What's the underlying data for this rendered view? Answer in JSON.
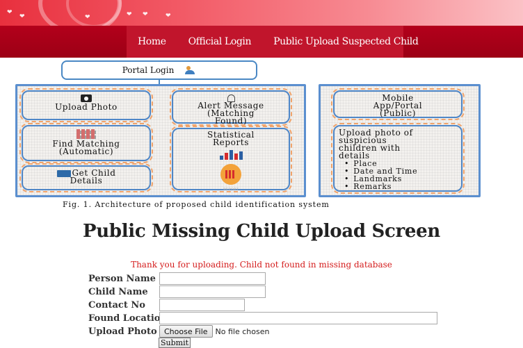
{
  "nav": {
    "items": [
      {
        "label": "Home"
      },
      {
        "label": "Official Login"
      },
      {
        "label": "Public Upload Suspected Child"
      }
    ]
  },
  "figure": {
    "portal_login": "Portal Login",
    "upload_photo": "Upload Photo",
    "find_matching_line1": "Find Matching",
    "find_matching_line2": "(Automatic)",
    "get_child_line1": "Get Child",
    "get_child_line2": "Details",
    "alert_line1": "Alert Message",
    "alert_line2": "(Matching",
    "alert_line3": "Found)",
    "stats_line1": "Statistical",
    "stats_line2": "Reports",
    "report_icon_text": "REPORT",
    "mobile_line1": "Mobile",
    "mobile_line2": "App/Portal",
    "mobile_line3": "(Public)",
    "upload_suspicious_line1": "Upload photo of",
    "upload_suspicious_line2": "suspicious",
    "upload_suspicious_line3": "children with",
    "upload_suspicious_line4": "details",
    "details": [
      "Place",
      "Date and Time",
      "Landmarks",
      "Remarks"
    ],
    "caption": "Fig. 1.    Architecture of proposed child identification system"
  },
  "page_title": "Public Missing Child Upload Screen",
  "status_message": "Thank you for uploading. Child not found in missing database",
  "form": {
    "person_name_label": "Person Name",
    "child_name_label": "Child Name",
    "contact_no_label": "Contact No",
    "found_location_label": "Found Location",
    "upload_photo_label": "Upload Photo",
    "choose_file_label": "Choose File",
    "file_status": "No file chosen",
    "submit_label": "Submit",
    "person_name_value": "",
    "child_name_value": "",
    "contact_no_value": "",
    "found_location_value": ""
  },
  "colors": {
    "nav_background": "#9c0015",
    "nav_active_background": "#c1152c",
    "status_message": "#d41c1c",
    "figure_border": "#5b8fcf",
    "figure_dash": "#f0a36b"
  }
}
